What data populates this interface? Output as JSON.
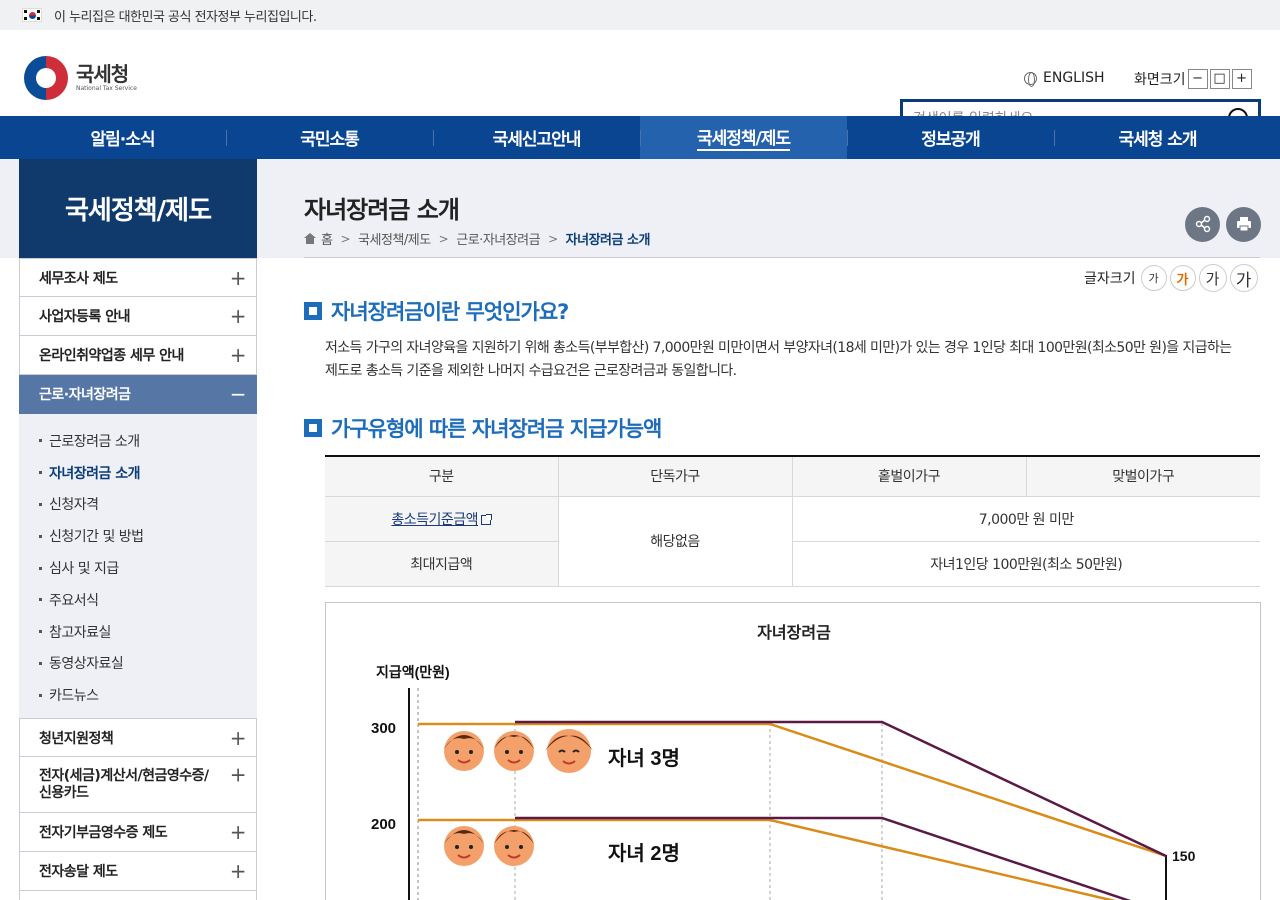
{
  "gov_bar": {
    "text": "이 누리집은 대한민국 공식 전자정부 누리집입니다."
  },
  "header": {
    "logo_kr": "국세청",
    "logo_en": "National Tax Service",
    "english": "ENGLISH",
    "zoom_label": "화면크기",
    "zoom_buttons": [
      "−",
      "□",
      "+"
    ],
    "search_placeholder": "검색어를 입력하세요"
  },
  "gnb": {
    "items": [
      "알림·소식",
      "국민소통",
      "국세신고안내",
      "국세정책/제도",
      "정보공개",
      "국세청 소개"
    ],
    "active": 3
  },
  "side": {
    "title": "국세정책/제도",
    "items_top": [
      "세무조사 제도",
      "사업자등록 안내",
      "온라인취약업종 세무 안내"
    ],
    "active_item": "근로·자녀장려금",
    "sub_items": [
      "근로장려금 소개",
      "자녀장려금 소개",
      "신청자격",
      "신청기간 및 방법",
      "심사 및 지급",
      "주요서식",
      "참고자료실",
      "동영상자료실",
      "카드뉴스"
    ],
    "active_sub": 1,
    "items_bottom": [
      "청년지원정책",
      "전자(세금)계산서/현금영수증/신용카드",
      "전자기부금영수증 제도",
      "전자송달 제도"
    ],
    "plus": "+",
    "minus": "−"
  },
  "content": {
    "title": "자녀장려금 소개",
    "breadcrumb": [
      "홈",
      "국세정책/제도",
      "근로·자녀장려금",
      "자녀장려금 소개"
    ],
    "font_size_label": "글자크기",
    "font_size_glyph": "가",
    "section1_title": "자녀장려금이란 무엇인가요?",
    "section1_desc": "저소득 가구의 자녀양육을 지원하기 위해 총소득(부부합산) 7,000만원 미만이면서 부양자녀(18세 미만)가 있는 경우 1인당 최대 100만원(최소50만 원)을 지급하는 제도로 총소득 기준을 제외한 나머지 수급요건은 근로장려금과 동일합니다.",
    "section2_title": "가구유형에 따른 자녀장려금 지급가능액",
    "table": {
      "headers": [
        "구분",
        "단독가구",
        "홑벌이가구",
        "맞벌이가구"
      ],
      "row1_label": "총소득기준금액",
      "row2_label": "최대지급액",
      "single_value": "해당없음",
      "row1_value": "7,000만 원 미만",
      "row2_value": "자녀1인당 100만원(최소 50만원)"
    }
  },
  "chart_data": {
    "type": "line",
    "title": "자녀장려금",
    "ylabel": "지급액(만원)",
    "y_ticks": [
      300,
      200
    ],
    "series": [
      {
        "name": "자녀 3명",
        "peak": 300,
        "end_label": "150"
      },
      {
        "name": "자녀 2명",
        "peak": 200
      }
    ]
  },
  "colors": {
    "primary_nav": "#0a4591",
    "active_nav": "#2462ad",
    "side_title_bg": "#103a6c",
    "section_blue": "#1e6dba",
    "chart_orange": "#d98c1a",
    "chart_purple": "#5a1a45"
  }
}
